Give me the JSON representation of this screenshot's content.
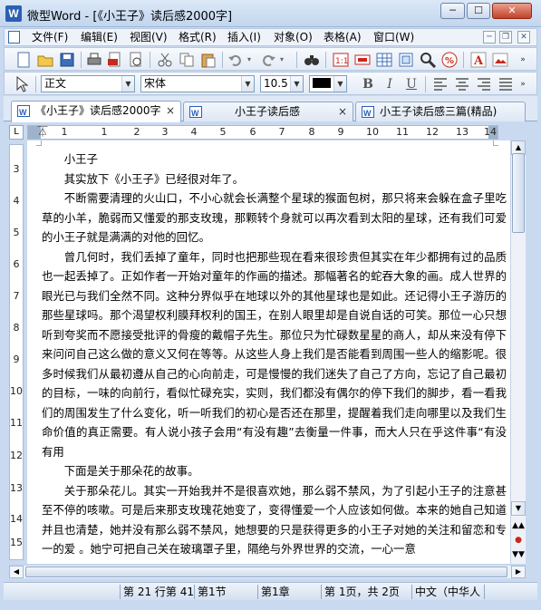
{
  "window": {
    "app_icon": "W",
    "title": "微型Word - [《小王子》读后感2000字]",
    "min_label": "─",
    "max_label": "☐",
    "close_label": "✕"
  },
  "menu": {
    "items": [
      "文件(F)",
      "编辑(E)",
      "视图(V)",
      "格式(R)",
      "插入(I)",
      "对象(O)",
      "表格(A)",
      "窗口(W)"
    ],
    "doc_minimize": "─",
    "doc_restore": "❐",
    "doc_close": "✕"
  },
  "toolbar2": {
    "style": "正文",
    "font": "宋体",
    "size": "10.5",
    "bold": "B",
    "italic": "I",
    "underline": "U"
  },
  "tabs": [
    {
      "label": "《小王子》读后感2000字",
      "close": "×"
    },
    {
      "label": "小王子读后感",
      "close": "×"
    },
    {
      "label": "小王子读后感三篇(精品)",
      "close": "×"
    }
  ],
  "ruler": {
    "corner": "L",
    "h_numbers": [
      "1",
      "1",
      "2",
      "3",
      "4",
      "5",
      "6",
      "7",
      "8",
      "9",
      "10",
      "11",
      "12",
      "13",
      "14"
    ],
    "v_numbers": [
      "3",
      "4",
      "5",
      "6",
      "7",
      "8",
      "9",
      "10",
      "11",
      "12",
      "13",
      "14",
      "15"
    ]
  },
  "document": {
    "heading": "小王子",
    "paragraphs": [
      "其实放下《小王子》已经很对年了。",
      "不断需要清理的火山口，不小心就会长满整个星球的猴面包树，那只将来会躲在盒子里吃草的小羊，脆弱而又懂爱的那支玫瑰，那颗转个身就可以再次看到太阳的星球，还有我们可爱的小王子就是满满的对他的回忆。",
      "曾几何时，我们丢掉了童年，同时也把那些现在看来很珍贵但其实在年少都拥有过的品质也一起丢掉了。正如作者一开始对童年的作画的描述。那幅著名的蛇吞大象的画。成人世界的眼光已与我们全然不同。这种分界似乎在地球以外的其他星球也是如此。还记得小王子游历的那些星球吗。那个渴望权利膜拜权利的国王，在别人眼里却是自说自话的可笑。那位一心只想听到夸奖而不愿接受批评的骨瘦的戴帽子先生。那位只为忙碌数星星的商人，却从来没有停下来问问自己这么做的意义又何在等等。从这些人身上我们是否能看到周围一些人的缩影呢。很多时候我们从最初遵从自己的心向前走，可是慢慢的我们迷失了自己了方向，忘记了自己最初的目标，一味的向前行，看似忙碌充实，实则，我们都没有偶尔的停下我们的脚步，看一看我们的周围发生了什么变化，听一听我们的初心是否还在那里，提醒着我们走向哪里以及我们生命价值的真正需要。有人说小孩子会用“有没有趣”去衡量一件事，而大人只在乎这件事“有没有用",
      "下面是关于那朵花的故事。",
      "关于那朵花儿。其实一开始我并不是很喜欢她，那么弱不禁风，为了引起小王子的注意甚至不停的咳嗽。可是后来那支玫瑰花她变了，变得懂爱一个人应该如何做。本来的她自己知道并且也清楚，她并没有那么弱不禁风，她想要的只是获得更多的小王子对她的关注和留恋和专一的爱 。她宁可把自己关在玻璃罩子里，隔绝与外界世界的交流，一心一意"
    ]
  },
  "status": {
    "position": "第 21 行第 41",
    "section": "第1节",
    "chapter": "第1章",
    "pages": "第 1页，共 2页",
    "language": "中文（中华人"
  }
}
